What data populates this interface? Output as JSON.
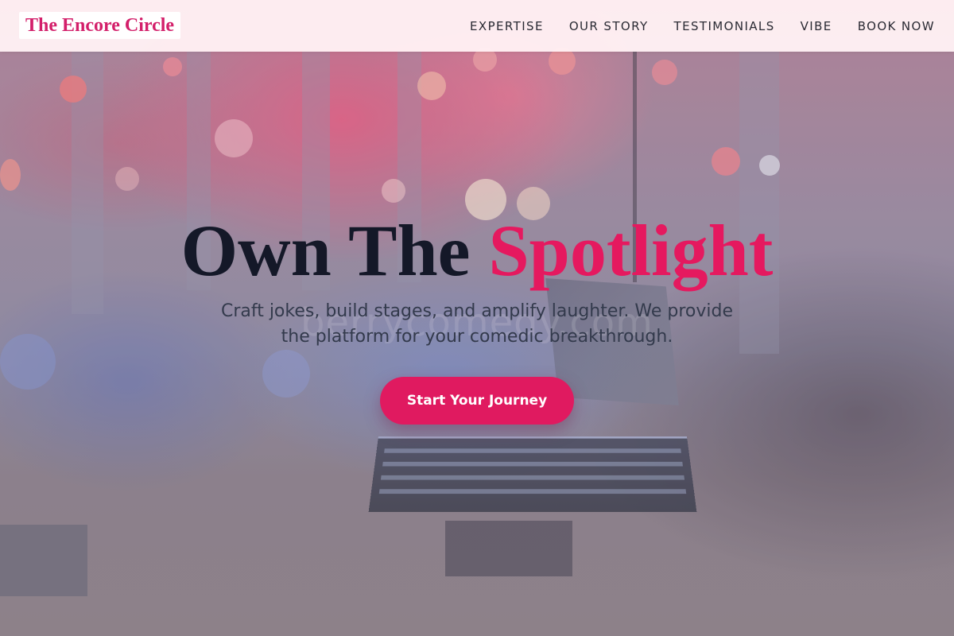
{
  "header": {
    "logo": "The Encore Circle",
    "nav": [
      {
        "label": "EXPERTISE"
      },
      {
        "label": "OUR STORY"
      },
      {
        "label": "TESTIMONIALS"
      },
      {
        "label": "VIBE"
      },
      {
        "label": "BOOK NOW"
      }
    ]
  },
  "hero": {
    "title_part1": "Own The ",
    "title_accent": "Spotlight",
    "subtitle": "Craft jokes, build stages, and amplify laughter. We provide the platform for your comedic breakthrough.",
    "cta_label": "Start Your Journey",
    "background_watermark": "berrycomedy.com"
  },
  "colors": {
    "accent": "#e5195f",
    "cta_background": "#e01a60",
    "header_background": "#fff0f4",
    "title_text": "#141828",
    "logo_text": "#d31f6a"
  }
}
